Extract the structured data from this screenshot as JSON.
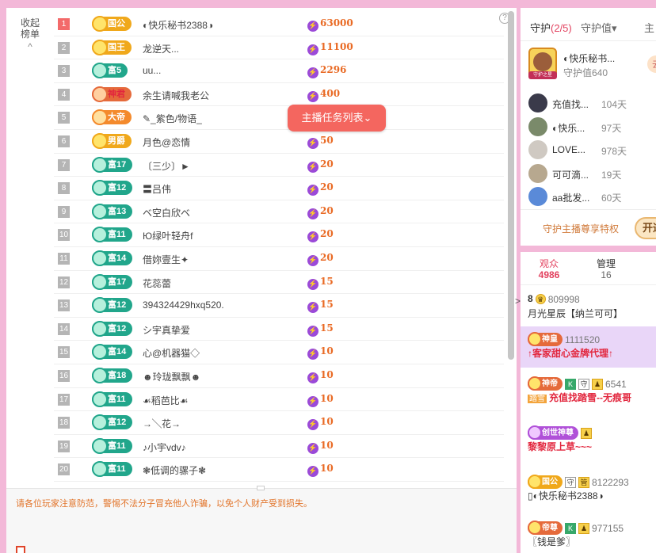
{
  "left_panel": {
    "collapse": {
      "line1": "收起",
      "line2": "榜单",
      "chevron": "^"
    },
    "help": "?",
    "task_button": "主播任务列表⌄",
    "notice": "请各位玩家注意防范，警惕不法分子冒充他人诈骗，以免个人财产受到损失。"
  },
  "rankings": [
    {
      "rank": "1",
      "badge": "国公",
      "style": "gold",
      "name": "◐快乐秘书2388◑",
      "score": "63000"
    },
    {
      "rank": "2",
      "badge": "国王",
      "style": "gold",
      "name": "龙逆天...",
      "score": "11100"
    },
    {
      "rank": "3",
      "badge": "富5",
      "style": "teal",
      "name": "uu...",
      "score": "2296"
    },
    {
      "rank": "4",
      "badge": "神君",
      "style": "red",
      "name": "余生请喊我老公",
      "score": "400"
    },
    {
      "rank": "5",
      "badge": "大帝",
      "style": "orange",
      "name": "✎_紫色/物语_",
      "score": ""
    },
    {
      "rank": "6",
      "badge": "男爵",
      "style": "gold",
      "name": "月色@恋情",
      "score": "50"
    },
    {
      "rank": "7",
      "badge": "富17",
      "style": "teal",
      "name": "〔三少〕►",
      "score": "20"
    },
    {
      "rank": "8",
      "badge": "富12",
      "style": "teal",
      "name": "〓吕伟",
      "score": "20"
    },
    {
      "rank": "9",
      "badge": "富13",
      "style": "teal",
      "name": "ベ空白欣ベ",
      "score": "20"
    },
    {
      "rank": "10",
      "badge": "富11",
      "style": "teal",
      "name": "Ю绿叶轻舟f",
      "score": "20"
    },
    {
      "rank": "11",
      "badge": "富14",
      "style": "teal",
      "name": "借妳壹生✦",
      "score": "20"
    },
    {
      "rank": "12",
      "badge": "富17",
      "style": "teal",
      "name": "花蕊蕾",
      "score": "15"
    },
    {
      "rank": "13",
      "badge": "富12",
      "style": "teal",
      "name": "394324429hxq520.",
      "score": "15"
    },
    {
      "rank": "14",
      "badge": "富12",
      "style": "teal",
      "name": "シ宇真挚爱",
      "score": "15"
    },
    {
      "rank": "15",
      "badge": "富14",
      "style": "teal",
      "name": "心@机器猫◇",
      "score": "10"
    },
    {
      "rank": "16",
      "badge": "富18",
      "style": "teal",
      "name": "☻玲珑飘飘☻",
      "score": "10"
    },
    {
      "rank": "17",
      "badge": "富11",
      "style": "teal",
      "name": "☙稻芭比☙",
      "score": "10"
    },
    {
      "rank": "18",
      "badge": "富12",
      "style": "teal",
      "name": "→╲花→",
      "score": "10"
    },
    {
      "rank": "19",
      "badge": "富11",
      "style": "teal",
      "name": "♪小宇vdv♪",
      "score": "10"
    },
    {
      "rank": "20",
      "badge": "富11",
      "style": "teal",
      "name": "❃低调的骡子❃",
      "score": "10"
    }
  ],
  "guard_panel": {
    "tab_guard": "守护",
    "tab_guard_count": "(2/5)",
    "tab_value": "守护值▾",
    "tab_third": "主",
    "top_guard": {
      "name": "◐快乐秘书...",
      "value": "守护值640",
      "badge_text": "守护之星",
      "go": "去"
    },
    "guards": [
      {
        "name": "充值找...",
        "days": "104天",
        "avatar_color": "#3a3a4a"
      },
      {
        "name": "◐快乐...",
        "days": "97天",
        "avatar_color": "#7a8a6a"
      },
      {
        "name": "LOVE...",
        "days": "978天",
        "avatar_color": "#cfc9c2"
      },
      {
        "name": "可可滴...",
        "days": "19天",
        "avatar_color": "#b7a88f"
      },
      {
        "name": "aa批发...",
        "days": "60天",
        "avatar_color": "#5a8ad8"
      }
    ],
    "privilege": "守护主播尊享特权",
    "open": "开通"
  },
  "viewers_panel": {
    "tab_audience": "观众",
    "audience_count": "4986",
    "tab_admin": "管理",
    "admin_count": "16",
    "arrow": ">",
    "viewers": [
      {
        "line1_prefix": "8",
        "id": "809998",
        "name": "月光星辰【纳兰可可】"
      },
      {
        "badge": "神皇",
        "id": "1111520",
        "name": "↑客家甜心金牌代理↑"
      },
      {
        "badge": "神帝",
        "tags": [
          "K",
          "守",
          "♟"
        ],
        "id": "6541",
        "name_prefix": "踏雪",
        "name": "充值找踏雪--无痕哥"
      },
      {
        "badge": "创世神尊",
        "tags": [
          "♟"
        ],
        "id": "",
        "name": "黎黎原上草~~~"
      },
      {
        "badge": "国公",
        "tags": [
          "守",
          "管"
        ],
        "id": "8122293",
        "name": "▯◐快乐秘书2388◑"
      },
      {
        "badge": "帝尊",
        "tags": [
          "K",
          "♟"
        ],
        "id": "977155",
        "name": "〖钱是爹〗"
      }
    ]
  },
  "colors": {
    "background": "#f3b8d8",
    "accent": "#e2425f",
    "score": "#e96a24",
    "task_button": "#f4665f"
  }
}
